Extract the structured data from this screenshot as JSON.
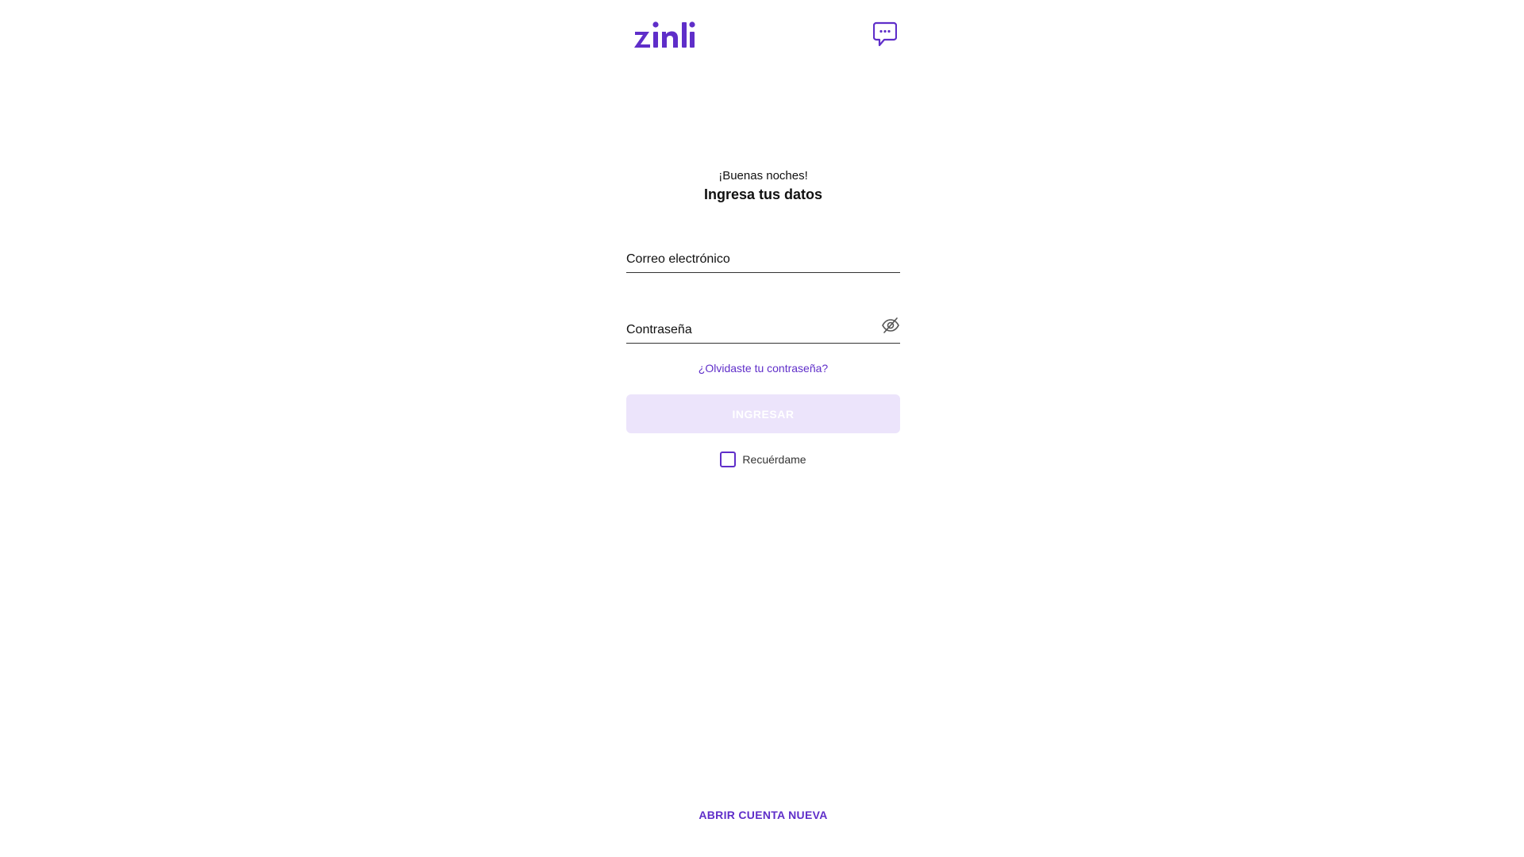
{
  "header": {
    "logo_text": "zinli",
    "chat_icon": "chat-bubble-icon"
  },
  "login": {
    "greeting": "¡Buenas noches!",
    "title": "Ingresa tus datos",
    "email_placeholder": "Correo electrónico",
    "email_value": "",
    "password_placeholder": "Contraseña",
    "password_value": "",
    "password_toggle_icon": "eye-off-icon",
    "forgot_label": "¿Olvidaste tu contraseña?",
    "submit_label": "INGRESAR",
    "remember_label": "Recuérdame",
    "remember_checked": false
  },
  "footer": {
    "open_account_label": "ABRIR CUENTA NUEVA"
  },
  "colors": {
    "brand": "#5f2ec9",
    "button_disabled_bg": "#ece4fb",
    "text": "#111111"
  }
}
